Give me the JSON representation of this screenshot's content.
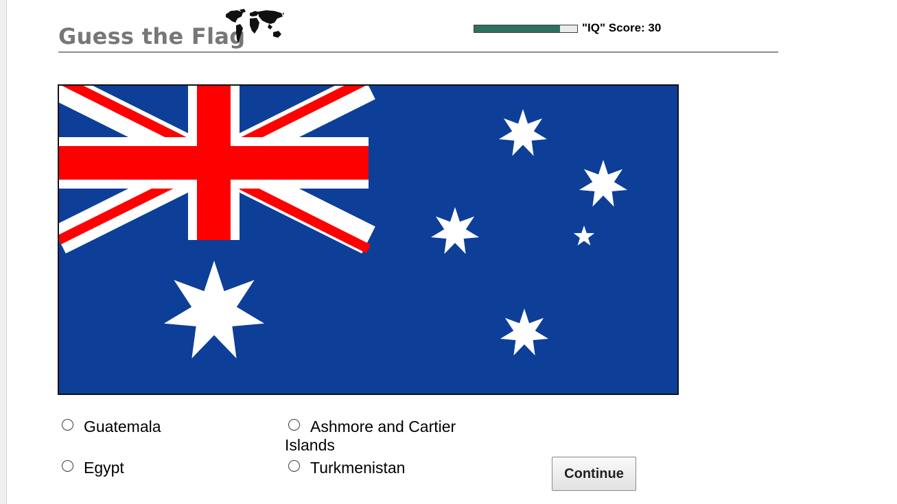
{
  "header": {
    "title": "Guess the Flag",
    "logo_icon": "world-map-icon",
    "score_label": "\"IQ\" Score: 30",
    "iq_progress": 0.83,
    "progress_color": "#2e7060"
  },
  "flag": {
    "icon": "australia-flag-icon",
    "colors": {
      "blue": "#0d3f99",
      "red": "#ff0000",
      "white": "#ffffff"
    }
  },
  "answers": [
    {
      "label": "Guatemala"
    },
    {
      "label": "Ashmore and Cartier"
    },
    {
      "label": "Islands"
    },
    {
      "label": "Egypt"
    },
    {
      "label": "Turkmenistan"
    }
  ],
  "continue_label": "Continue"
}
